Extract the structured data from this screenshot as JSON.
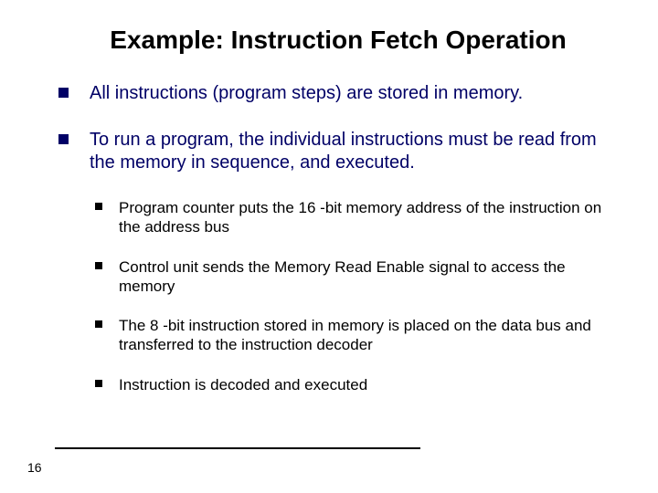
{
  "title": "Example: Instruction Fetch Operation",
  "main_bullets": [
    "All instructions (program steps) are stored in memory.",
    "To run a program, the individual instructions must be read from the memory in sequence, and executed."
  ],
  "sub_bullets": [
    "Program counter puts the 16 -bit memory address of the instruction on the address bus",
    "Control unit sends the Memory Read Enable signal to access the memory",
    "The 8 -bit instruction stored in memory is placed on the data bus and transferred to the instruction decoder",
    "Instruction is decoded and executed"
  ],
  "page_number": "16"
}
